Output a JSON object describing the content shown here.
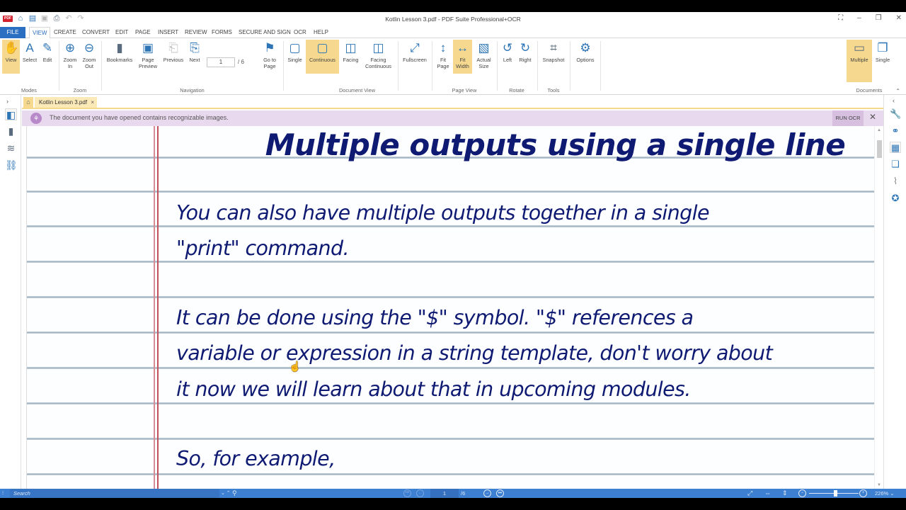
{
  "window": {
    "title": "Kotlin Lesson 3.pdf   -   PDF Suite  Professional+OCR",
    "controls": [
      "fullscreen-toggle",
      "minimize",
      "restore",
      "close"
    ]
  },
  "quick_access": {
    "logo": "PDF",
    "items": [
      "home-icon",
      "open-icon",
      "save-icon",
      "print-icon",
      "undo-icon",
      "redo-icon"
    ]
  },
  "menu": {
    "file": "FILE",
    "tabs": [
      "VIEW",
      "CREATE",
      "CONVERT",
      "EDIT",
      "PAGE",
      "INSERT",
      "REVIEW",
      "FORMS",
      "SECURE AND SIGN",
      "OCR",
      "HELP"
    ],
    "active": "VIEW"
  },
  "ribbon": {
    "modes": {
      "label": "Modes",
      "view": "View",
      "select": "Select",
      "edit": "Edit"
    },
    "zoom": {
      "label": "Zoom",
      "zoom_in": [
        "Zoom",
        "In"
      ],
      "zoom_out": [
        "Zoom",
        "Out"
      ]
    },
    "navigation": {
      "label": "Navigation",
      "bookmarks": "Bookmarks",
      "page_preview": [
        "Page",
        "Preview"
      ],
      "previous": "Previous",
      "next": "Next",
      "current_page": "1",
      "total_pages": "/   6",
      "go_to_page": [
        "Go to",
        "Page"
      ]
    },
    "document_view": {
      "label": "Document View",
      "single": "Single",
      "continuous": "Continuous",
      "facing": "Facing",
      "facing_continuous": [
        "Facing",
        "Continuous"
      ],
      "fullscreen": "Fullscreen"
    },
    "page_view": {
      "label": "Page View",
      "fit_page": [
        "Fit",
        "Page"
      ],
      "fit_width": [
        "Fit",
        "Width"
      ],
      "actual_size": [
        "Actual",
        "Size"
      ]
    },
    "rotate": {
      "label": "Rotate",
      "left": "Left",
      "right": "Right"
    },
    "tools": {
      "label": "Tools",
      "snapshot": "Snapshot",
      "options": "Options"
    },
    "documents": {
      "label": "Documents",
      "multiple": "Multiple",
      "single": "Single"
    }
  },
  "doc_tabs": {
    "home": "home-icon",
    "tabs": [
      {
        "label": "Kotlin Lesson 3.pdf",
        "close": "×"
      }
    ]
  },
  "notice": {
    "text": "The document you have opened contains recognizable images.",
    "action": "RUN OCR",
    "close": "✕"
  },
  "left_sidebar": [
    "page-thumbnails-icon",
    "bookmarks-icon",
    "layers-icon",
    "links-icon"
  ],
  "right_sidebar": [
    "tools-wrench-icon",
    "find-binoculars-icon",
    "image-tools-icon",
    "comments-icon",
    "attachments-icon",
    "certificate-icon"
  ],
  "document": {
    "title": "Multiple outputs using a single line",
    "lines": [
      "You can also have multiple outputs together in a single",
      "\"print\" command.",
      "It can be done using the \"$\" symbol. \"$\" references a",
      "variable or expression in a string template, don't worry about",
      "it now we will learn about that in upcoming modules.",
      "So, for example,"
    ]
  },
  "statusbar": {
    "search_placeholder": "Search",
    "search_options": "⌄ ⌃",
    "current_page": "1",
    "total_pages": "/6",
    "zoom_level": "226%",
    "zoom_dropdown": "⌄",
    "zoom_slider_fraction": 0.53
  }
}
